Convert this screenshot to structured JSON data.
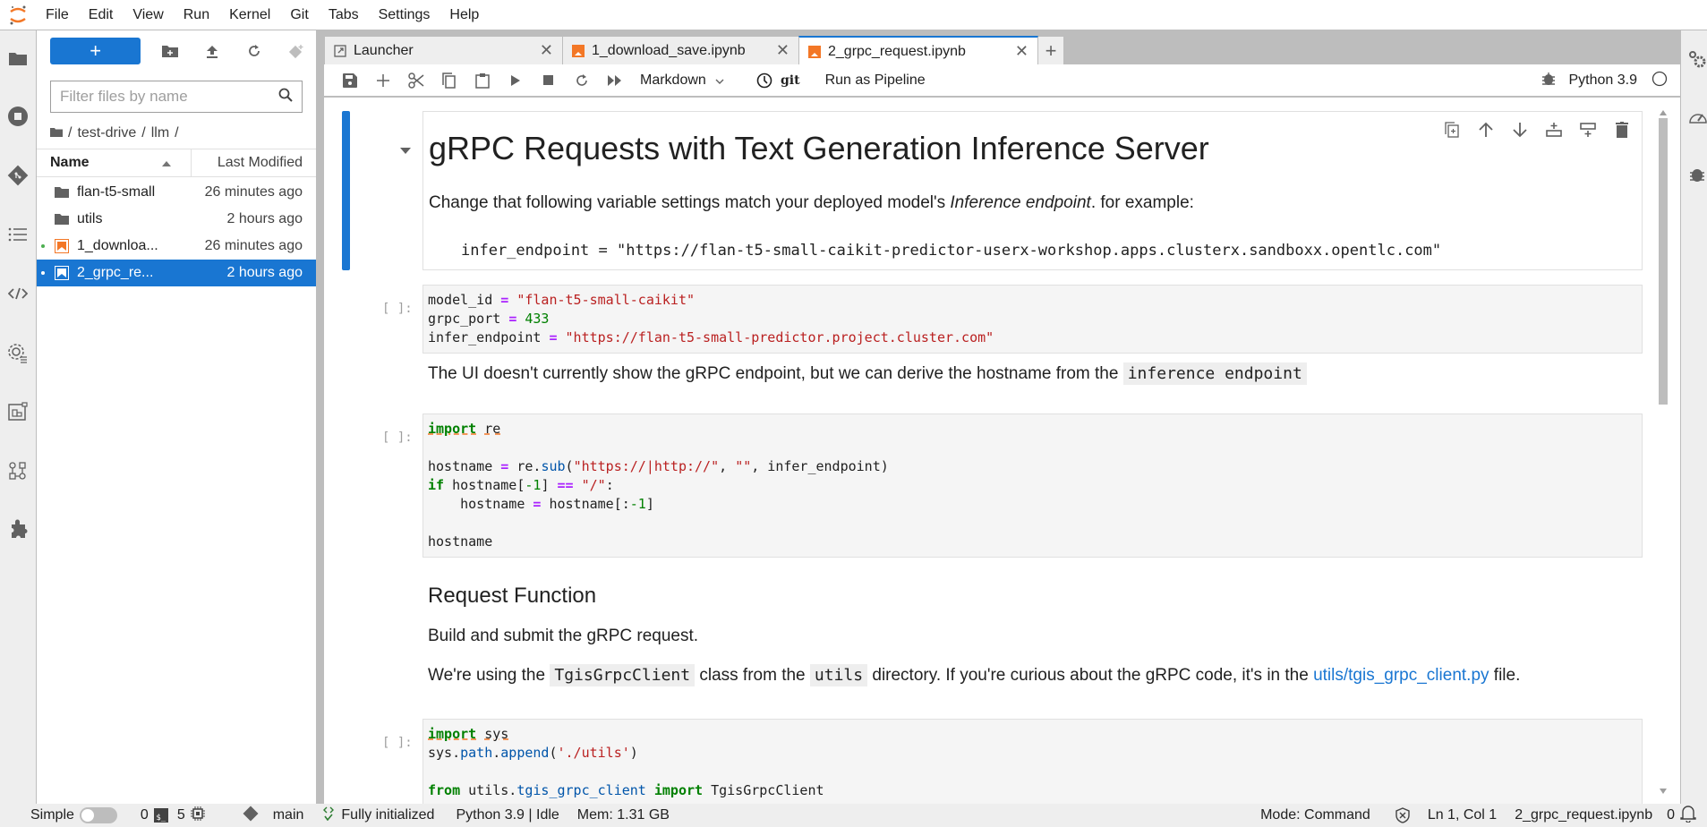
{
  "menubar": {
    "items": [
      "File",
      "Edit",
      "View",
      "Run",
      "Kernel",
      "Git",
      "Tabs",
      "Settings",
      "Help"
    ]
  },
  "filebrowser": {
    "new_label": "+",
    "filter_placeholder": "Filter files by name",
    "breadcrumb": [
      "/",
      "test-drive",
      "/",
      "llm",
      "/"
    ],
    "columns": {
      "name": "Name",
      "modified": "Last Modified"
    },
    "files": [
      {
        "name": "flan-t5-small",
        "modified": "26 minutes ago",
        "type": "folder",
        "running": false,
        "selected": false
      },
      {
        "name": "utils",
        "modified": "2 hours ago",
        "type": "folder",
        "running": false,
        "selected": false
      },
      {
        "name": "1_downloa...",
        "modified": "26 minutes ago",
        "type": "notebook",
        "running": true,
        "selected": false
      },
      {
        "name": "2_grpc_re...",
        "modified": "2 hours ago",
        "type": "notebook",
        "running": true,
        "selected": true
      }
    ]
  },
  "tabs": [
    {
      "label": "Launcher",
      "icon": "launcher-icon",
      "active": false
    },
    {
      "label": "1_download_save.ipynb",
      "icon": "notebook-icon",
      "active": false
    },
    {
      "label": "2_grpc_request.ipynb",
      "icon": "notebook-icon",
      "active": true
    }
  ],
  "toolbar": {
    "cell_type": "Markdown",
    "git_label": "git",
    "pipeline_label": "Run as Pipeline",
    "kernel_name": "Python 3.9"
  },
  "notebook": {
    "heading": "gRPC Requests with Text Generation Inference Server",
    "intro_before": "Change that following variable settings match your deployed model's ",
    "intro_em": "Inference endpoint",
    "intro_after": ". for example:",
    "example_code": "infer_endpoint = \"https://flan-t5-small-caikit-predictor-userx-workshop.apps.clusterx.sandboxx.opentlc.com\"",
    "prompt": "[ ]:",
    "cell1": {
      "line1_var": "model_id",
      "line1_val": "\"flan-t5-small-caikit\"",
      "line2_var": "grpc_port",
      "line2_val": "433",
      "line3_var": "infer_endpoint",
      "line3_val": "\"https://flan-t5-small-predictor.project.cluster.com\""
    },
    "md2_text": "The UI doesn't currently show the gRPC endpoint, but we can derive the hostname from the ",
    "md2_code": "inference endpoint",
    "cell2": {
      "import_kw": "import",
      "import_mod": "re",
      "l3_a": "hostname ",
      "l3_b": " re.",
      "l3_fn": "sub",
      "l3_c": "(",
      "l3_s1": "\"https://|http://\"",
      "l3_d": ", ",
      "l3_s2": "\"\"",
      "l3_e": ", infer_endpoint)",
      "l4_kw": "if",
      "l4_a": " hostname[",
      "l4_n": "-1",
      "l4_b": "] ",
      "l4_op": "==",
      "l4_s": "\"/\"",
      "l4_c": ":",
      "l5_a": "    hostname ",
      "l5_b": " hostname[:",
      "l5_n": "-1",
      "l5_c": "]",
      "l7": "hostname"
    },
    "md3_heading": "Request Function",
    "md3_p1": "Build and submit the gRPC request.",
    "md3_p2_a": "We're using the ",
    "md3_p2_code1": "TgisGrpcClient",
    "md3_p2_b": " class from the ",
    "md3_p2_code2": "utils",
    "md3_p2_c": " directory. If you're curious about the gRPC code, it's in the ",
    "md3_p2_link": "utils/tgis_grpc_client.py",
    "md3_p2_d": " file.",
    "cell3": {
      "import_kw": "import",
      "import_mod": "sys",
      "l2_a": "sys.",
      "l2_fn1": "path",
      "l2_b": ".",
      "l2_fn2": "append",
      "l2_c": "(",
      "l2_s": "'./utils'",
      "l2_d": ")",
      "l4_kw1": "from",
      "l4_a": " utils.",
      "l4_mod": "tgis_grpc_client",
      "l4_kw2": "import",
      "l4_b": " TgisGrpcClient"
    }
  },
  "statusbar": {
    "mode_label": "Simple",
    "terminals": "0",
    "kernels": "5",
    "branch": "main",
    "lsp_status": "Fully initialized",
    "kernel_status": "Python 3.9 | Idle",
    "memory": "Mem: 1.31 GB",
    "notebook_mode": "Mode: Command",
    "cursor": "Ln 1, Col 1",
    "filename": "2_grpc_request.ipynb",
    "notifications": "0"
  },
  "colors": {
    "accent": "#1976d2",
    "notebook_icon": "#f37726",
    "keyword": "#008000",
    "string": "#ba2121",
    "operator": "#aa22ff"
  }
}
